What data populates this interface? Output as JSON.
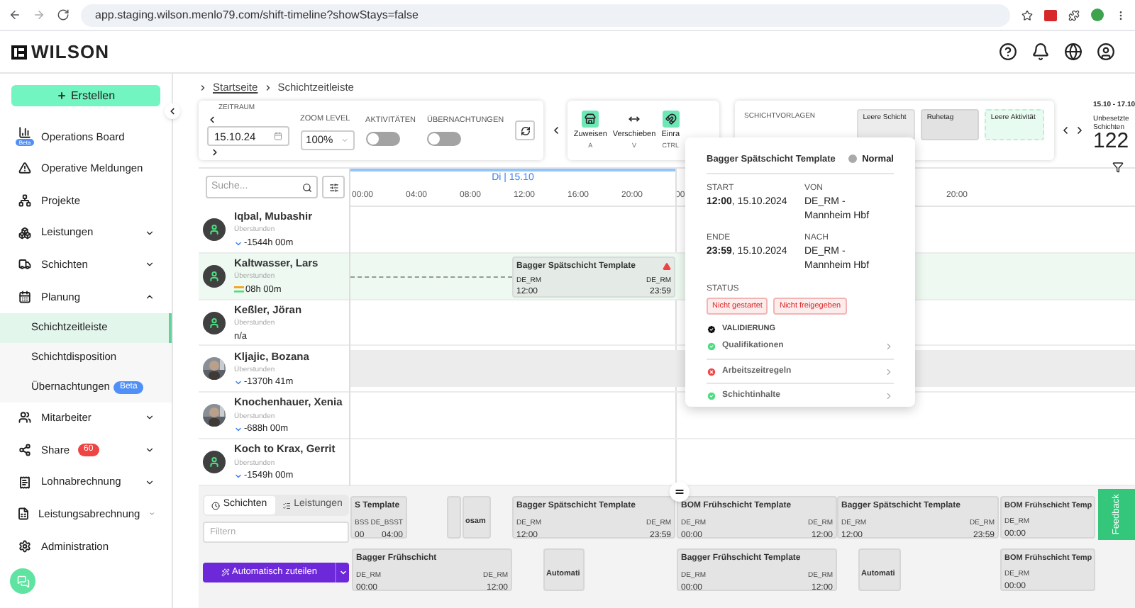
{
  "browser": {
    "url": "app.staging.wilson.menlo79.com/shift-timeline?showStays=false"
  },
  "header": {
    "logo": "WILSON"
  },
  "sidebar": {
    "create_button": "Erstellen",
    "items": [
      {
        "label": "Operations Board",
        "selected": false,
        "badge": {
          "text": "Beta",
          "kind": "icon",
          "color": "#4f8ff7"
        }
      },
      {
        "label": "Operative Meldungen",
        "selected": false
      },
      {
        "label": "Projekte",
        "selected": false
      },
      {
        "label": "Leistungen",
        "selected": false,
        "expanded": false
      },
      {
        "label": "Schichten",
        "selected": false,
        "expanded": false
      },
      {
        "label": "Planung",
        "selected": false,
        "expanded": true,
        "children": [
          {
            "label": "Schichtzeitleiste",
            "selected": true
          },
          {
            "label": "Schichtdisposition",
            "selected": false
          },
          {
            "label": "Übernachtungen",
            "selected": false,
            "badge": {
              "text": "Beta",
              "kind": "inline",
              "color": "#4f8ff7"
            }
          }
        ]
      },
      {
        "label": "Mitarbeiter",
        "selected": false,
        "expanded": false
      },
      {
        "label": "Share",
        "selected": false,
        "expanded": false,
        "badge": {
          "text": "60",
          "kind": "inline",
          "color": "#ef4444"
        }
      },
      {
        "label": "Lohnabrechnung",
        "selected": false,
        "expanded": false
      },
      {
        "label": "Leistungsabrechnung",
        "selected": false,
        "expanded": false
      },
      {
        "label": "Administration",
        "selected": false
      }
    ]
  },
  "breadcrumb": [
    "Startseite",
    "Schichtzeitleiste"
  ],
  "toolbar": {
    "period": {
      "label": "ZEITRAUM",
      "date": "15.10.24"
    },
    "zoom": {
      "label": "ZOOM LEVEL",
      "value": "100%"
    },
    "toggles": [
      {
        "label": "AKTIVITÄTEN",
        "on": false
      },
      {
        "label": "ÜBERNACHTUNGEN",
        "on": false
      }
    ]
  },
  "tools": [
    {
      "label": "Zuweisen",
      "shortcut": "A",
      "active": true
    },
    {
      "label": "Verschieben",
      "shortcut": "V",
      "active": false
    },
    {
      "label": "Einra",
      "shortcut": "CTRL",
      "active": true
    }
  ],
  "templates": {
    "label": "SCHICHTVORLAGEN",
    "items": [
      {
        "label": "Leere Schicht",
        "kind": "shift"
      },
      {
        "label": "Ruhetag",
        "kind": "rest"
      },
      {
        "label": "Leere Aktivität",
        "kind": "activity"
      }
    ]
  },
  "summary": {
    "range": "15.10 - 17.10",
    "label": "Unbesetzte Schichten",
    "count": "122"
  },
  "timeline": {
    "search_placeholder": "Suche...",
    "day": "Di | 15.10",
    "hours": [
      "00:00",
      "04:00",
      "08:00",
      "12:00",
      "16:00",
      "20:00",
      "00"
    ],
    "next_hours": [
      "20:00"
    ]
  },
  "employees": [
    {
      "name": "Iqbal, Mubashir",
      "overtime_label": "Überstunden",
      "overtime": "-1544h 00m",
      "trend": {
        "kind": "down"
      },
      "avatar": {
        "kind": "placeholder"
      },
      "selected": false,
      "unavailable": false
    },
    {
      "name": "Kaltwasser, Lars",
      "overtime_label": "Überstunden",
      "overtime": "08h 00m",
      "trend": {
        "kind": "even"
      },
      "avatar": {
        "kind": "placeholder"
      },
      "selected": true,
      "unavailable": false,
      "shifts": [
        {
          "title": "Bagger Spätschicht Template",
          "from": "DE_RM",
          "to": "DE_RM",
          "start": "12:00",
          "end": "23:59",
          "warning": true
        }
      ]
    },
    {
      "name": "Keßler, Jöran",
      "overtime_label": "Überstunden",
      "overtime": "n/a",
      "trend": {
        "kind": "none"
      },
      "avatar": {
        "kind": "placeholder"
      },
      "selected": false,
      "unavailable": false
    },
    {
      "name": "Kljajic, Bozana",
      "overtime_label": "Überstunden",
      "overtime": "-1370h 41m",
      "trend": {
        "kind": "down"
      },
      "selected": false,
      "unavailable": true
    },
    {
      "name": "Knochenhauer, Xenia",
      "overtime_label": "Überstunden",
      "overtime": "-688h 00m",
      "trend": {
        "kind": "down"
      },
      "selected": false,
      "unavailable": false
    },
    {
      "name": "Koch to Krax, Gerrit",
      "overtime_label": "Überstunden",
      "overtime": "-1549h 00m",
      "trend": {
        "kind": "down"
      },
      "avatar": {
        "kind": "placeholder"
      },
      "selected": false,
      "unavailable": false
    }
  ],
  "popover": {
    "title": "Bagger Spätschicht Template",
    "priority": "Normal",
    "start_label": "START",
    "start": "**12:00**, 15.10.2024",
    "from_label": "VON",
    "from": "DE_RM - Mannheim Hbf",
    "end_label": "ENDE",
    "end": "**23:59**, 15.10.2024",
    "to_label": "NACH",
    "to": "DE_RM - Mannheim Hbf",
    "status_label": "STATUS",
    "statuses": [
      "Nicht gestartet",
      "Nicht freigegeben"
    ],
    "validation_label": "VALIDIERUNG",
    "checks": [
      {
        "label": "Qualifikationen",
        "ok": true
      },
      {
        "label": "Arbeitszeitregeln",
        "ok": false
      },
      {
        "label": "Schichtinhalte",
        "ok": true
      }
    ]
  },
  "bottom": {
    "tabs": [
      {
        "label": "Schichten",
        "selected": true
      },
      {
        "label": "Leistungen",
        "selected": false
      }
    ],
    "filter_placeholder": "Filtern",
    "auto_button": "Automatisch zuteilen",
    "lanes": [
      {
        "cards": [
          {
            "kind": "full",
            "title": "S Template",
            "from": "BSS",
            "to": "DE_BSST",
            "start": "00",
            "end": "04:00"
          },
          {
            "kind": "blank"
          },
          {
            "kind": "title",
            "title": "osam"
          },
          {
            "kind": "full",
            "title": "Bagger Spätschicht Template",
            "from": "DE_RM",
            "to": "DE_RM",
            "start": "12:00",
            "end": "23:59"
          },
          {
            "kind": "full",
            "title": "BOM Frühschicht Template",
            "from": "DE_RM",
            "to": "DE_RM",
            "start": "00:00",
            "end": "12:00"
          },
          {
            "kind": "full",
            "title": "Bagger Spätschicht Template",
            "from": "DE_RM",
            "to": "DE_RM",
            "start": "12:00",
            "end": "23:59"
          },
          {
            "kind": "partial",
            "title": "BOM Frühschicht Temp",
            "from": "DE_RM",
            "start": "00:00"
          }
        ]
      },
      {
        "cards": [
          {
            "kind": "full",
            "title": "Bagger Frühschicht",
            "from": "DE_RM",
            "to": "DE_RM",
            "start": "00:00",
            "end": "12:00"
          },
          {
            "kind": "title",
            "title": "Automati"
          },
          {
            "kind": "full",
            "title": "Bagger Frühschicht Template",
            "from": "DE_RM",
            "to": "DE_RM",
            "start": "00:00",
            "end": "12:00"
          },
          {
            "kind": "title",
            "title": "Automati"
          },
          {
            "kind": "partial",
            "title": "BOM Frühschicht Temp",
            "from": "DE_RM",
            "start": "00:00"
          }
        ]
      }
    ]
  },
  "feedback": "Feedback"
}
